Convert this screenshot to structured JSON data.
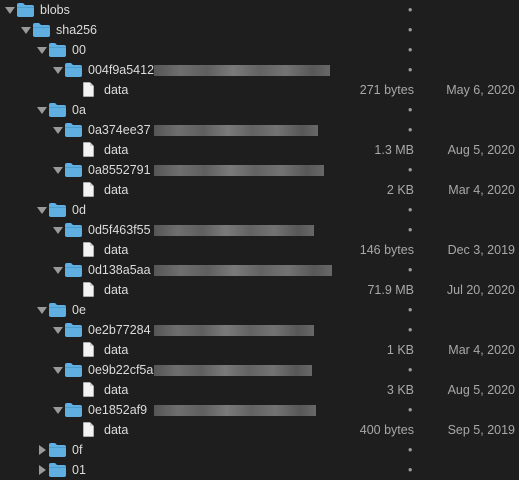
{
  "tree": {
    "blobs": "blobs",
    "sha256": "sha256",
    "rows": [
      {
        "kind": "folder",
        "depth": 2,
        "expanded": true,
        "name": "00"
      },
      {
        "kind": "folder",
        "depth": 3,
        "expanded": true,
        "name": "004f9a5412",
        "redacted": true
      },
      {
        "kind": "file",
        "depth": 4,
        "name": "data",
        "size": "271 bytes",
        "date": "May 6, 2020"
      },
      {
        "kind": "folder",
        "depth": 2,
        "expanded": true,
        "name": "0a"
      },
      {
        "kind": "folder",
        "depth": 3,
        "expanded": true,
        "name": "0a374ee37",
        "redacted": true
      },
      {
        "kind": "file",
        "depth": 4,
        "name": "data",
        "size": "1.3 MB",
        "date": "Aug 5, 2020"
      },
      {
        "kind": "folder",
        "depth": 3,
        "expanded": true,
        "name": "0a8552791",
        "redacted": true
      },
      {
        "kind": "file",
        "depth": 4,
        "name": "data",
        "size": "2 KB",
        "date": "Mar 4, 2020"
      },
      {
        "kind": "folder",
        "depth": 2,
        "expanded": true,
        "name": "0d"
      },
      {
        "kind": "folder",
        "depth": 3,
        "expanded": true,
        "name": "0d5f463f55",
        "redacted": true
      },
      {
        "kind": "file",
        "depth": 4,
        "name": "data",
        "size": "146 bytes",
        "date": "Dec 3, 2019"
      },
      {
        "kind": "folder",
        "depth": 3,
        "expanded": true,
        "name": "0d138a5aa",
        "redacted": true
      },
      {
        "kind": "file",
        "depth": 4,
        "name": "data",
        "size": "71.9 MB",
        "date": "Jul 20, 2020"
      },
      {
        "kind": "folder",
        "depth": 2,
        "expanded": true,
        "name": "0e"
      },
      {
        "kind": "folder",
        "depth": 3,
        "expanded": true,
        "name": "0e2b77284",
        "redacted": true
      },
      {
        "kind": "file",
        "depth": 4,
        "name": "data",
        "size": "1 KB",
        "date": "Mar 4, 2020"
      },
      {
        "kind": "folder",
        "depth": 3,
        "expanded": true,
        "name": "0e9b22cf5a",
        "redacted": true
      },
      {
        "kind": "file",
        "depth": 4,
        "name": "data",
        "size": "3 KB",
        "date": "Aug 5, 2020"
      },
      {
        "kind": "folder",
        "depth": 3,
        "expanded": true,
        "name": "0e1852af9",
        "redacted": true
      },
      {
        "kind": "file",
        "depth": 4,
        "name": "data",
        "size": "400 bytes",
        "date": "Sep 5, 2019"
      },
      {
        "kind": "folder",
        "depth": 2,
        "expanded": false,
        "name": "0f"
      },
      {
        "kind": "folder",
        "depth": 2,
        "expanded": false,
        "name": "01"
      }
    ],
    "dot": "•"
  },
  "colors": {
    "background": "#1e1e1e",
    "folder": "#5fb0e0",
    "folder_tab": "#4a9ccc",
    "text": "#dcdcdc",
    "secondary": "#a8a8a8"
  }
}
